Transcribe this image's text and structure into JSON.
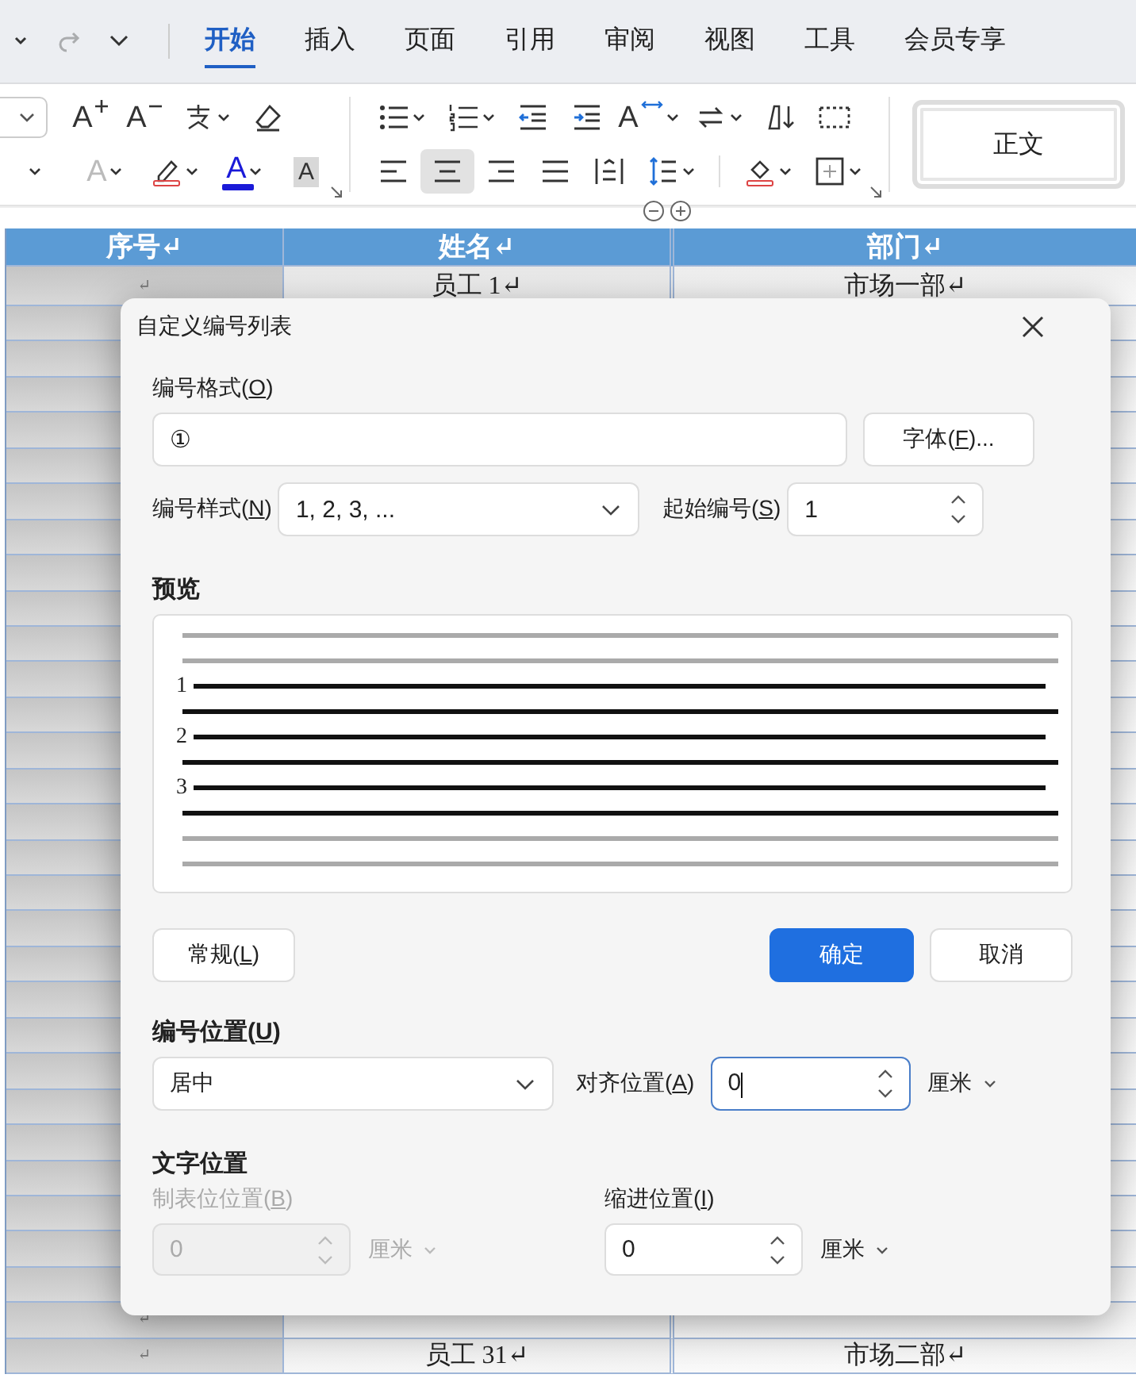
{
  "quick_access": [
    {
      "kind": "caret",
      "disabled": false
    },
    {
      "kind": "redo",
      "disabled": true
    },
    {
      "kind": "chevron",
      "disabled": false
    }
  ],
  "tabs": [
    {
      "label": "开始",
      "selected": true
    },
    {
      "label": "插入",
      "selected": false
    },
    {
      "label": "页面",
      "selected": false
    },
    {
      "label": "引用",
      "selected": false
    },
    {
      "label": "审阅",
      "selected": false
    },
    {
      "label": "视图",
      "selected": false
    },
    {
      "label": "工具",
      "selected": false
    },
    {
      "label": "会员专享",
      "selected": false
    }
  ],
  "toolbar": {
    "groups": [
      {
        "rows": [
          [
            {
              "kind": "font-size-box"
            },
            {
              "kind": "grow-font",
              "glyph": "A",
              "caret": false
            },
            {
              "kind": "shrink-font",
              "glyph": "A",
              "caret": false
            },
            {
              "kind": "pinyin",
              "caret": true
            },
            {
              "kind": "eraser",
              "caret": false
            }
          ],
          [
            {
              "kind": "more",
              "caret": true
            },
            {
              "kind": "text-effect",
              "glyph": "A",
              "caret": true
            },
            {
              "kind": "highlight",
              "caret": true
            },
            {
              "kind": "font-color",
              "glyph": "A",
              "caret": true
            },
            {
              "kind": "char-shade",
              "glyph": "A",
              "caret": false
            }
          ]
        ]
      },
      {
        "rows": [
          [
            {
              "kind": "bullets",
              "caret": true
            },
            {
              "kind": "numbering",
              "caret": true
            },
            {
              "kind": "outdent",
              "caret": false
            },
            {
              "kind": "indent",
              "caret": false
            },
            {
              "kind": "text-direction",
              "glyph": "A",
              "caret": true
            },
            {
              "kind": "swap",
              "caret": true
            },
            {
              "kind": "sort",
              "caret": false
            },
            {
              "kind": "table-border",
              "caret": false
            }
          ],
          [
            {
              "kind": "align-left",
              "caret": false,
              "selected": false
            },
            {
              "kind": "align-center",
              "caret": false,
              "selected": true
            },
            {
              "kind": "align-right",
              "caret": false,
              "selected": false
            },
            {
              "kind": "justify",
              "caret": false,
              "selected": false
            },
            {
              "kind": "distribute",
              "caret": false,
              "selected": false
            },
            {
              "kind": "line-spacing",
              "caret": true
            },
            {
              "kind": "sep"
            },
            {
              "kind": "shading",
              "caret": true
            },
            {
              "kind": "borders",
              "caret": true
            }
          ]
        ]
      }
    ],
    "style_box": {
      "label": "正文"
    }
  },
  "table": {
    "columns": [
      "序号↵",
      "姓名↵",
      "部门↵"
    ],
    "rows_top": [
      {
        "cells": [
          "↵",
          "员工 1↵",
          "市场一部↵"
        ]
      }
    ],
    "rows_bottom": [
      {
        "cells": [
          "↵"
        ]
      },
      {
        "cells": [
          "↵",
          "员工 31↵",
          "市场二部↵"
        ]
      }
    ]
  },
  "dialog": {
    "title": "自定义编号列表",
    "number_format": {
      "label": [
        "编号格式(",
        "O",
        ")"
      ],
      "value": "①"
    },
    "font_button": [
      "字体(",
      "F",
      ")..."
    ],
    "number_style": {
      "label": [
        "编号样式(",
        "N",
        ")"
      ],
      "value": "1, 2, 3, ..."
    },
    "start_at": {
      "label": [
        "起始编号(",
        "S",
        ")"
      ],
      "value": "1"
    },
    "preview": {
      "label": "预览",
      "numbers": [
        "1",
        "2",
        "3"
      ]
    },
    "buttons": [
      {
        "kind": "normal",
        "label": [
          "常规(",
          "L",
          ")"
        ]
      },
      {
        "kind": "primary",
        "label": [
          "确定"
        ]
      },
      {
        "kind": "normal",
        "label": [
          "取消"
        ]
      }
    ],
    "number_position": {
      "label": [
        "编号位置(",
        "U",
        ")"
      ],
      "value": "居中",
      "align_label": [
        "对齐位置(",
        "A",
        ")"
      ],
      "align_value": "0",
      "focused": true,
      "unit": "厘米"
    },
    "text_position": {
      "label": "文字位置",
      "tab": {
        "label": [
          "制表位位置(",
          "B",
          ")"
        ],
        "value": "0",
        "unit": "厘米",
        "disabled": true
      },
      "indent": {
        "label": [
          "缩进位置(",
          "I",
          ")"
        ],
        "value": "0",
        "unit": "厘米",
        "disabled": false
      }
    }
  }
}
